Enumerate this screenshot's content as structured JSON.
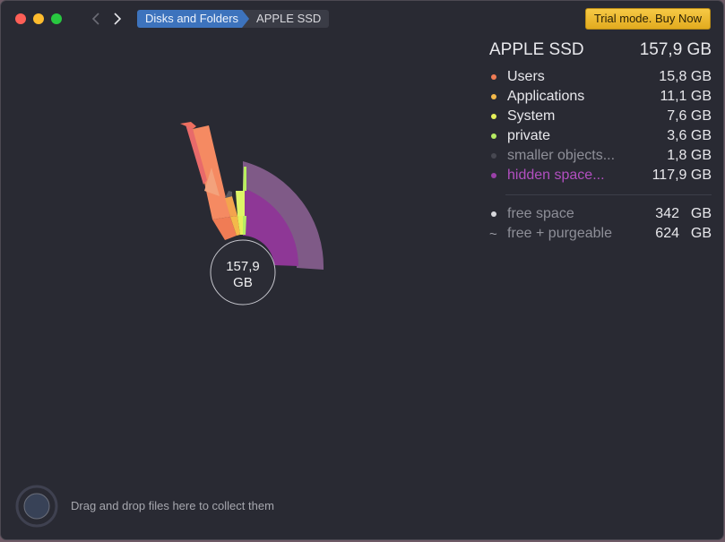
{
  "window": {
    "breadcrumb": [
      "Disks and Folders",
      "APPLE SSD"
    ],
    "trial_button": "Trial mode. Buy Now"
  },
  "chart": {
    "center_label_value": "157,9",
    "center_label_unit": "GB"
  },
  "legend": {
    "disk_name": "APPLE SSD",
    "disk_total": "157,9 GB",
    "items": [
      {
        "name": "Users",
        "size": "15,8 GB",
        "color": "#f07c55"
      },
      {
        "name": "Applications",
        "size": "11,1 GB",
        "color": "#f4b94a"
      },
      {
        "name": "System",
        "size": "7,6 GB",
        "color": "#e5f05a"
      },
      {
        "name": "private",
        "size": "3,6 GB",
        "color": "#b6ec63"
      },
      {
        "name": "smaller objects...",
        "size": "1,8 GB",
        "color": "#474851"
      },
      {
        "name": "hidden space...",
        "size": "117,9 GB",
        "color": "#9a40a8"
      }
    ],
    "free": [
      {
        "name": "free space",
        "value": "342",
        "unit": "GB"
      },
      {
        "name": "free + purgeable",
        "value": "624",
        "unit": "GB"
      }
    ]
  },
  "drop_zone": {
    "hint": "Drag and drop files here to collect them"
  }
}
